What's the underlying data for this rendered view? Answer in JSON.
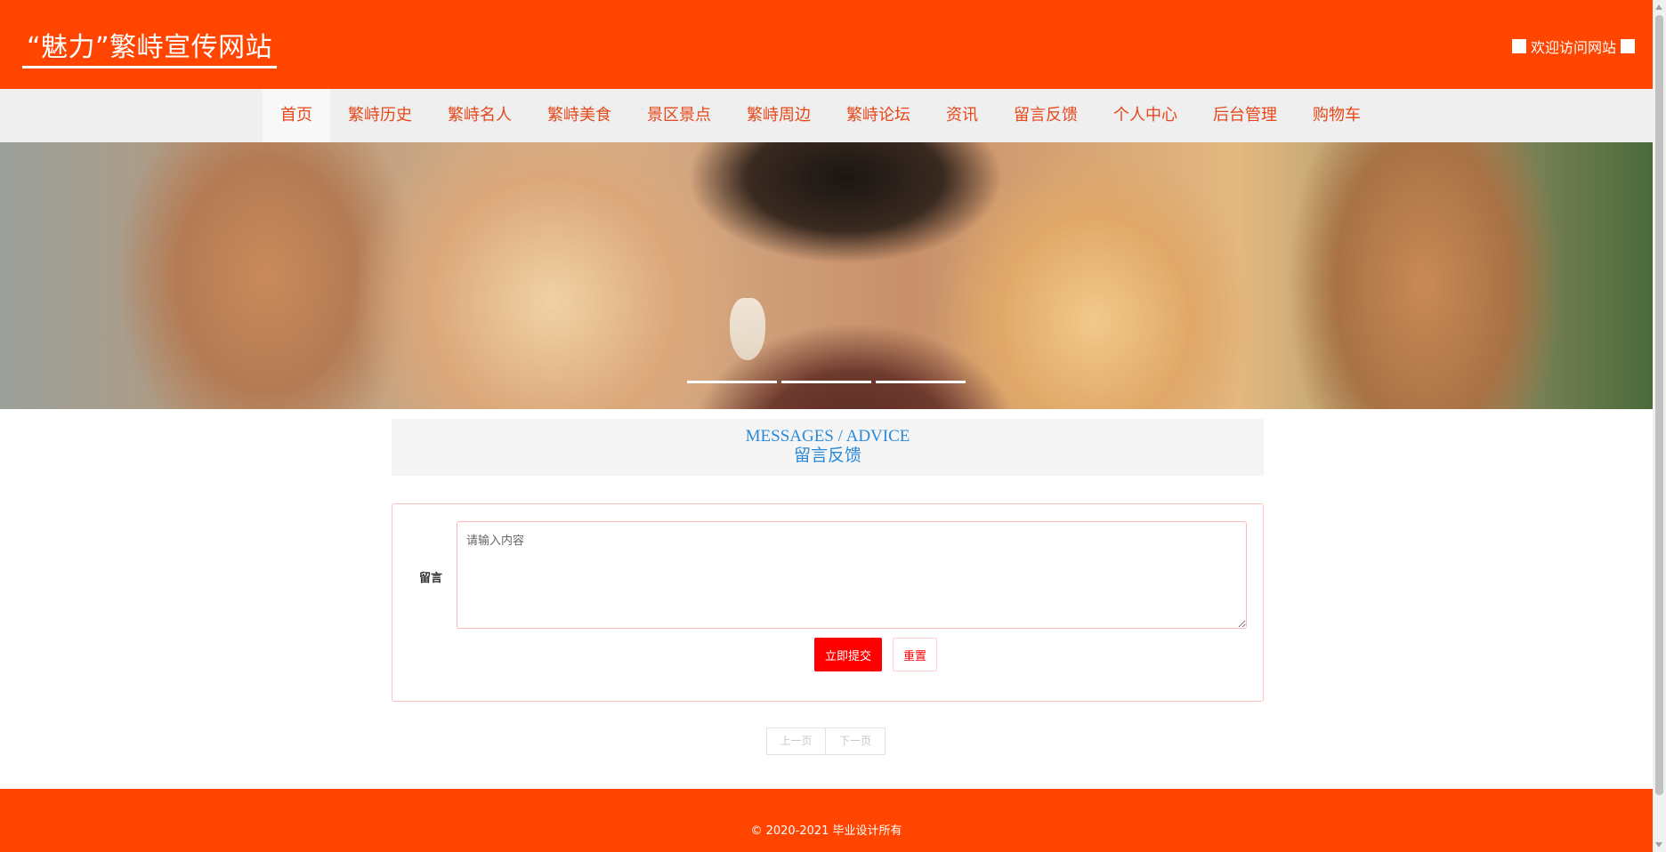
{
  "header": {
    "site_title": "“魅力”繁峙宣传网站",
    "welcome_text": "欢迎访问网站"
  },
  "nav": {
    "items": [
      {
        "label": "首页",
        "active": true
      },
      {
        "label": "繁峙历史"
      },
      {
        "label": "繁峙名人"
      },
      {
        "label": "繁峙美食"
      },
      {
        "label": "景区景点"
      },
      {
        "label": "繁峙周边"
      },
      {
        "label": "繁峙论坛"
      },
      {
        "label": "资讯"
      },
      {
        "label": "留言反馈"
      },
      {
        "label": "个人中心"
      },
      {
        "label": "后台管理"
      },
      {
        "label": "购物车"
      }
    ]
  },
  "banner": {
    "slide_count": 3
  },
  "section": {
    "title_en": "MESSAGES / ADVICE",
    "title_cn": "留言反馈"
  },
  "form": {
    "label": "留言",
    "placeholder": "请输入内容",
    "value": "",
    "submit_label": "立即提交",
    "reset_label": "重置"
  },
  "pagination": {
    "prev_label": "上一页",
    "next_label": "下一页"
  },
  "footer": {
    "copyright": "© 2020-2021 毕业设计所有"
  },
  "colors": {
    "brand": "#ff4500",
    "nav_text": "#e8471a",
    "accent_blue": "#2a8ad8",
    "submit_red": "#ff0000"
  }
}
